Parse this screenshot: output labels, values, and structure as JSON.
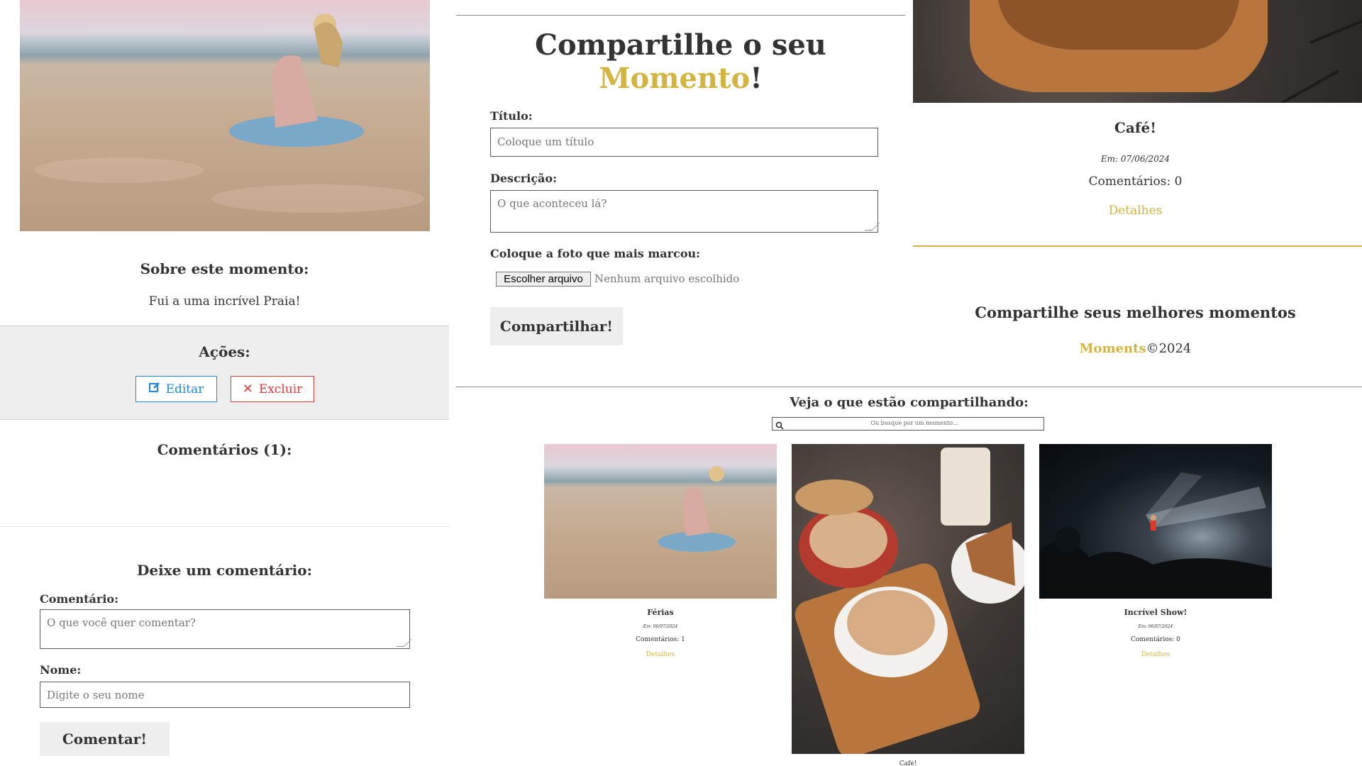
{
  "left": {
    "about_title": "Sobre este momento:",
    "about_text": "Fui a uma incrível Praia!",
    "actions_title": "Ações:",
    "edit_label": "Editar",
    "delete_label": "Excluir",
    "comments_title": "Comentários (1):",
    "leave_comment_title": "Deixe um comentário:",
    "comment_label": "Comentário:",
    "comment_placeholder": "O que você quer comentar?",
    "name_label": "Nome:",
    "name_placeholder": "Digite o seu nome",
    "submit_label": "Comentar!"
  },
  "form": {
    "title_part1": "Compartilhe o seu ",
    "title_highlight": "Momento",
    "title_end": "!",
    "title_label": "Título:",
    "title_placeholder": "Coloque um título",
    "description_label": "Descrição:",
    "description_placeholder": "O que aconteceu lá?",
    "photo_label": "Coloque a foto que mais marcou:",
    "file_button": "Escolher arquivo",
    "file_status": "Nenhum arquivo escolhido",
    "submit_label": "Compartilhar!"
  },
  "right": {
    "card_title": "Café!",
    "card_date": "Em: 07/06/2024",
    "card_comments": "Comentários: 0",
    "card_details": "Detalhes",
    "footer_title": "Compartilhe seus melhores momentos",
    "footer_brand": "Moments",
    "footer_copy": "©2024"
  },
  "feed": {
    "title": "Veja o que estão compartilhando:",
    "search_placeholder": "Ou busque por um momento...",
    "cards": [
      {
        "title": "Férias",
        "date": "Em: 06/07/2024",
        "comments": "Comentários: 1",
        "details": "Detalhes"
      },
      {
        "title": "",
        "date": "",
        "comments": "",
        "details": ""
      },
      {
        "title": "Incrível Show!",
        "date": "Em: 06/07/2024",
        "comments": "Comentários: 0",
        "details": "Detalhes"
      }
    ],
    "cut_caption": "Café!"
  },
  "colors": {
    "accent": "#d4b441",
    "edit_blue": "#1e88e5",
    "delete_red": "#e53935",
    "panel_grey": "#eeeeee"
  },
  "icons": [
    "edit-icon",
    "close-icon",
    "search-icon"
  ]
}
